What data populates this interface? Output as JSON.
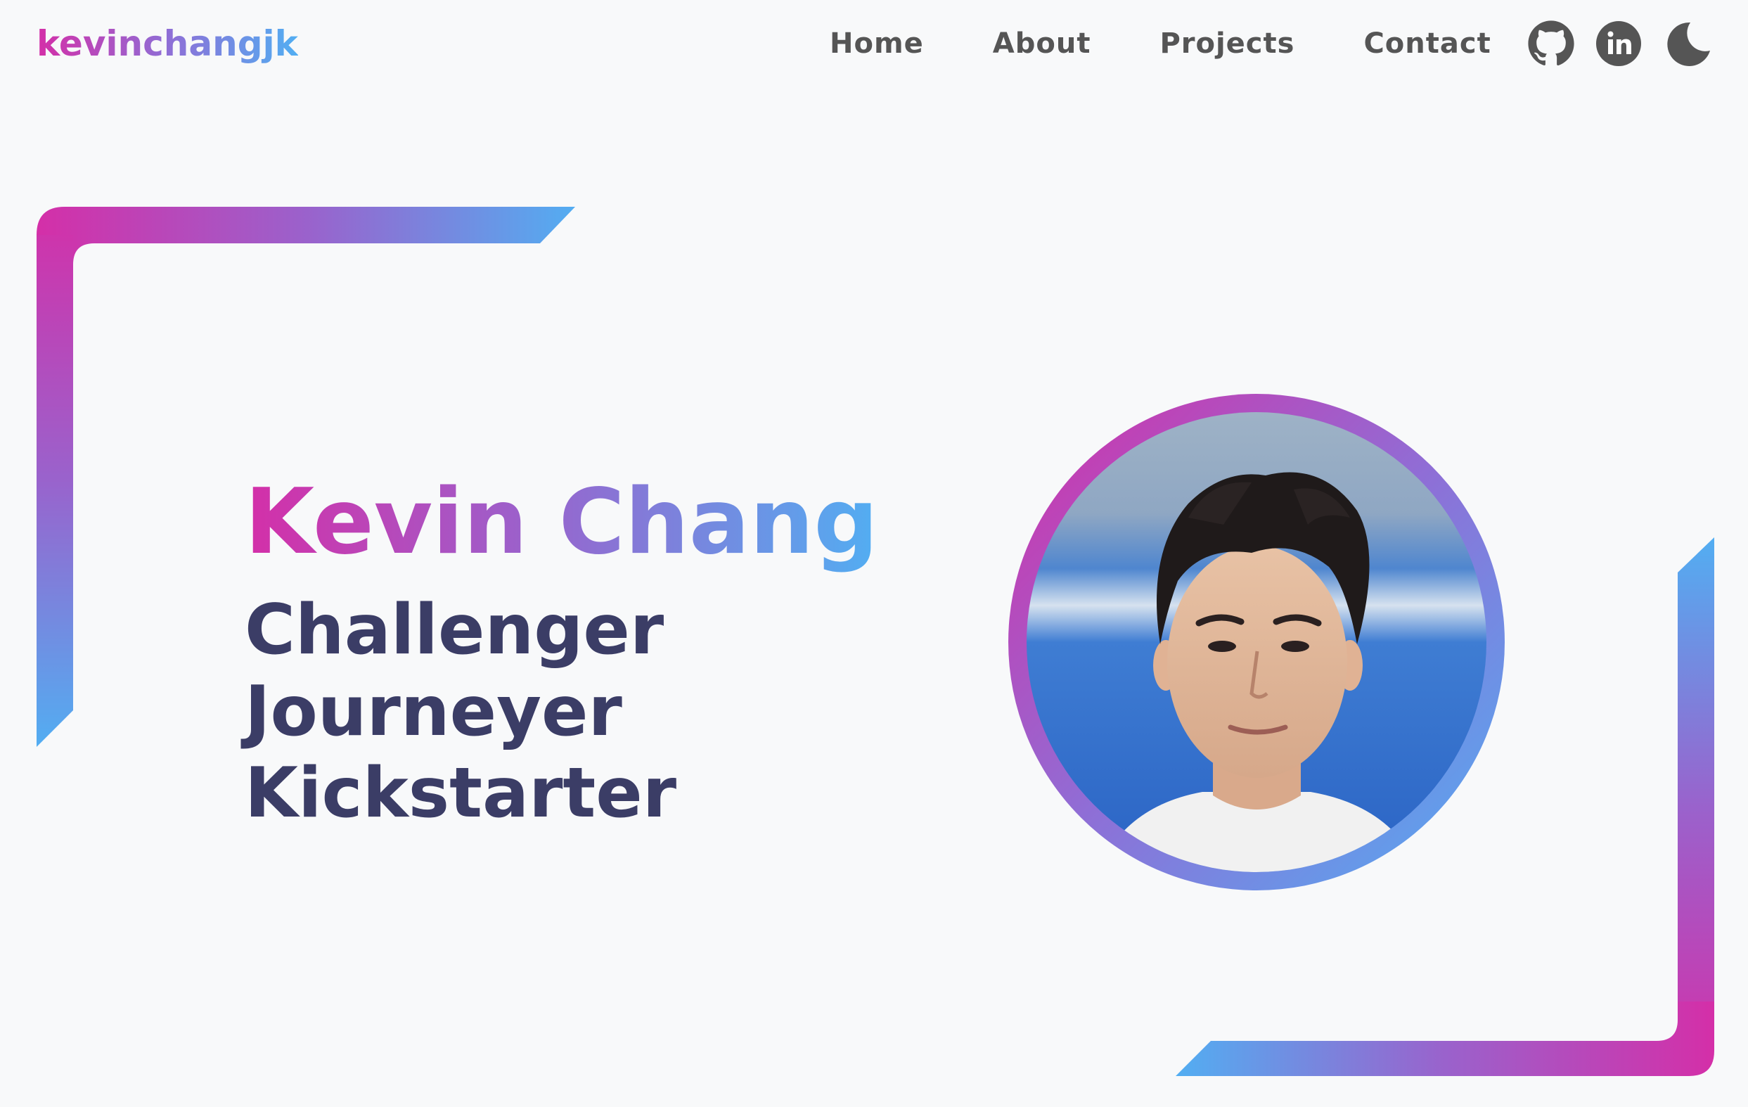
{
  "brand": {
    "text": "kevinchangjk"
  },
  "nav": {
    "links": [
      {
        "label": "Home"
      },
      {
        "label": "About"
      },
      {
        "label": "Projects"
      },
      {
        "label": "Contact"
      }
    ],
    "icons": [
      {
        "name": "github-icon"
      },
      {
        "name": "linkedin-icon"
      },
      {
        "name": "moon-icon"
      }
    ]
  },
  "hero": {
    "name": "Kevin Chang",
    "words": [
      "Challenger",
      "Journeyer",
      "Kickstarter"
    ]
  },
  "colors": {
    "accent_pink": "#d42fa8",
    "accent_purple": "#8f6ed6",
    "accent_blue": "#52aef2",
    "text_dark": "#3b3d66",
    "nav_text": "#555555",
    "background": "#f8f9fa"
  }
}
